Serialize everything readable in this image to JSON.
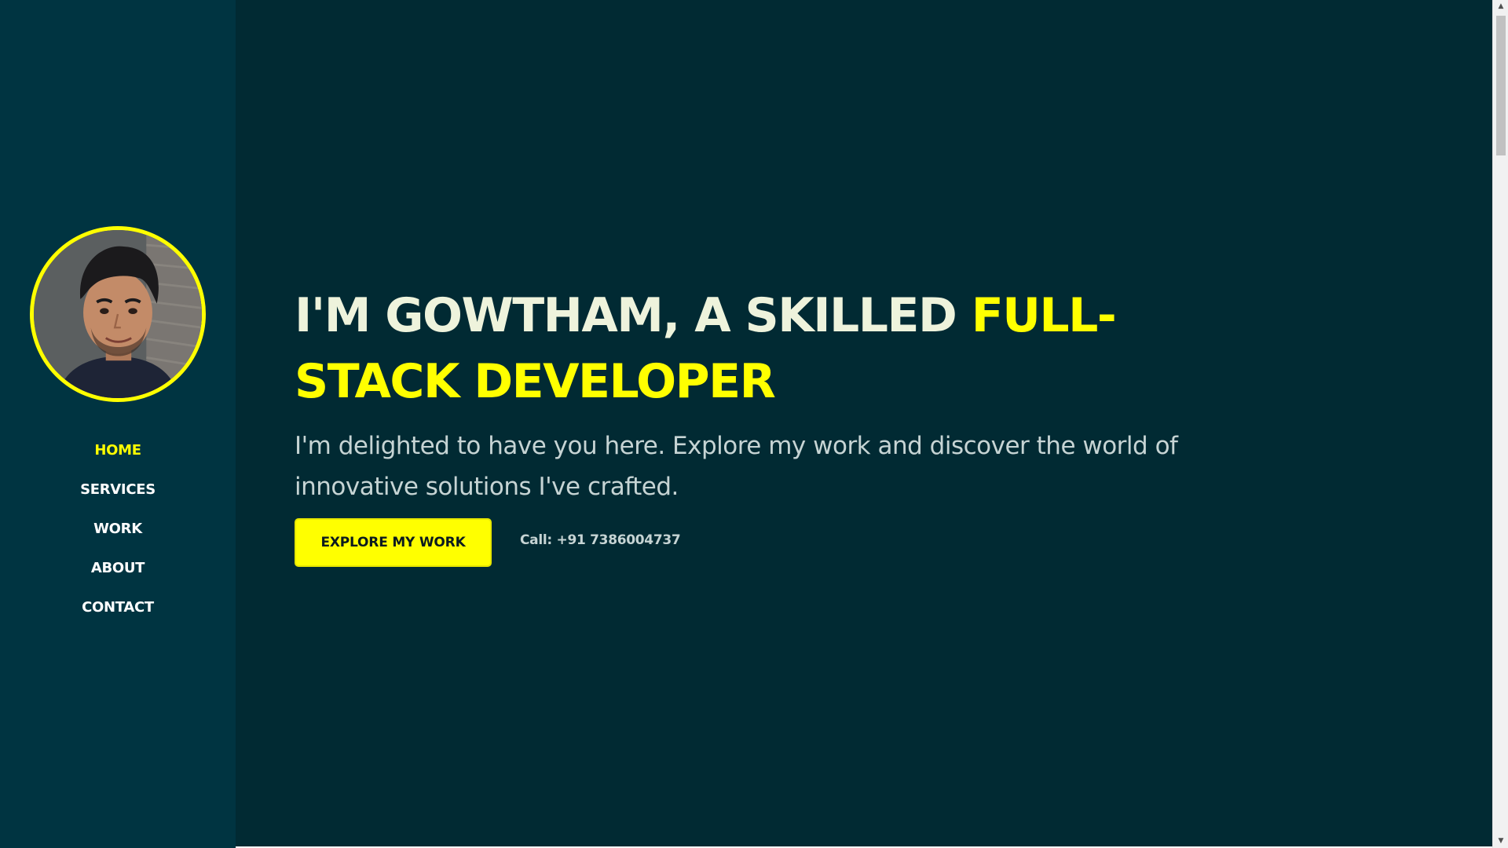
{
  "colors": {
    "sidebar_bg": "#003441",
    "main_bg": "#012a33",
    "accent": "#ffff00",
    "headline_text": "#eef3dc",
    "body_text": "#c6d4d4"
  },
  "sidebar": {
    "avatar_alt": "profile photo",
    "nav": [
      {
        "label": "HOME",
        "active": true
      },
      {
        "label": "SERVICES",
        "active": false
      },
      {
        "label": "WORK",
        "active": false
      },
      {
        "label": "ABOUT",
        "active": false
      },
      {
        "label": "CONTACT",
        "active": false
      }
    ]
  },
  "hero": {
    "headline_plain": "I'M GOWTHAM, A SKILLED ",
    "headline_highlight": "FULL-STACK DEVELOPER",
    "subtitle": "I'm delighted to have you here. Explore my work and discover the world of innovative solutions I've crafted.",
    "cta_label": "EXPLORE MY WORK",
    "call_text": "Call: +91 7386004737"
  },
  "scrollbar": {
    "up_icon": "triangle-up-icon",
    "down_icon": "triangle-down-icon",
    "up_glyph": "▲",
    "down_glyph": "▼"
  }
}
